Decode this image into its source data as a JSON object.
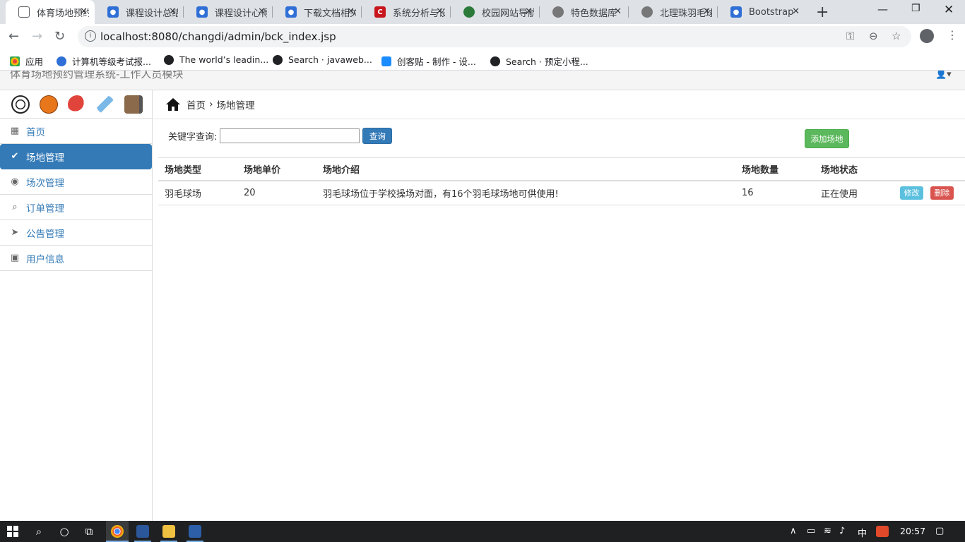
{
  "browser": {
    "tabs": [
      {
        "label": "体育场地预约管理",
        "color": "#e8eaed",
        "glyph": ""
      },
      {
        "label": "课程设计总结",
        "color": "#2f6fd6",
        "glyph": "🐾"
      },
      {
        "label": "课程设计心得",
        "color": "#2f6fd6",
        "glyph": "🐾"
      },
      {
        "label": "下载文档相关",
        "color": "#2f6fd6",
        "glyph": "🐾"
      },
      {
        "label": "系统分析与设计",
        "color": "#c7161c",
        "glyph": "C"
      },
      {
        "label": "校园网站导航",
        "color": "#2b7a3a",
        "glyph": "●"
      },
      {
        "label": "特色数据库",
        "color": "#777777",
        "glyph": "◉"
      },
      {
        "label": "北理珠羽毛球",
        "color": "#777777",
        "glyph": "◉"
      },
      {
        "label": "Bootstrap",
        "color": "#2f6fd6",
        "glyph": "🐾"
      }
    ],
    "url": "localhost:8080/changdi/admin/bck_index.jsp",
    "bookmarks": [
      {
        "label": "应用",
        "color": "#e8453c"
      },
      {
        "label": "计算机等级考试报...",
        "color": "#2f6fd6"
      },
      {
        "label": "The world’s leadin...",
        "color": "#202124"
      },
      {
        "label": "Search · javaweb...",
        "color": "#202124"
      },
      {
        "label": "创客贴 - 制作 - 设...",
        "color": "#1a8cff"
      },
      {
        "label": "Search · 预定小程...",
        "color": "#202124"
      }
    ]
  },
  "header": {
    "title": "体育场地预约管理系统-工作人员模块"
  },
  "sidebar": {
    "items": [
      {
        "label": "首页",
        "icon": "dashboard-icon",
        "glyph": "▦"
      },
      {
        "label": "场地管理",
        "icon": "ok-circle-icon",
        "glyph": "✔"
      },
      {
        "label": "场次管理",
        "icon": "check-circle-icon",
        "glyph": "◉"
      },
      {
        "label": "订单管理",
        "icon": "search-icon",
        "glyph": "⌕"
      },
      {
        "label": "公告管理",
        "icon": "send-icon",
        "glyph": "➤"
      },
      {
        "label": "用户信息",
        "icon": "user-info-icon",
        "glyph": "▣"
      }
    ]
  },
  "breadcrumb": {
    "home": "首页",
    "current": "场地管理"
  },
  "search": {
    "label": "关键字查询:",
    "value": "",
    "button": "查询"
  },
  "add_button": "添加场地",
  "table": {
    "headers": [
      "场地类型",
      "场地单价",
      "场地介绍",
      "场地数量",
      "场地状态"
    ],
    "rows": [
      {
        "cells": [
          "羽毛球场",
          "20",
          "羽毛球场位于学校操场对面，有16个羽毛球场地可供使用!",
          "16",
          "正在使用"
        ],
        "edit": "修改",
        "delete": "删除"
      }
    ]
  },
  "taskbar": {
    "time": "20:57",
    "ime": "中"
  },
  "colors": {
    "primary": "#337ab7",
    "success": "#5cb85c",
    "info": "#5bc0de",
    "danger": "#d9534f"
  }
}
